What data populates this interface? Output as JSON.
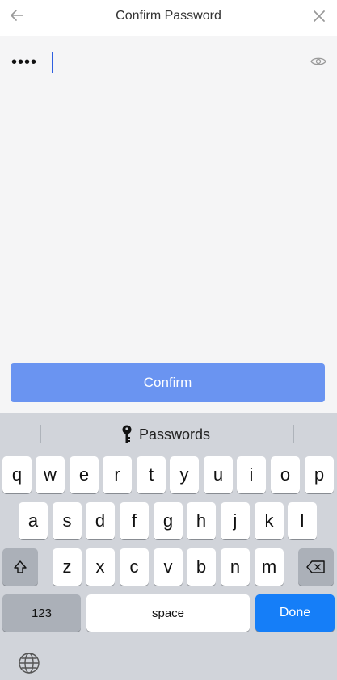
{
  "header": {
    "title": "Confirm Password"
  },
  "password": {
    "masked_value": "••••"
  },
  "confirm_button": {
    "label": "Confirm",
    "color": "#6a94f1"
  },
  "keyboard": {
    "suggestion": "Passwords",
    "row1": [
      "q",
      "w",
      "e",
      "r",
      "t",
      "y",
      "u",
      "i",
      "o",
      "p"
    ],
    "row2": [
      "a",
      "s",
      "d",
      "f",
      "g",
      "h",
      "j",
      "k",
      "l"
    ],
    "row3": [
      "z",
      "x",
      "c",
      "v",
      "b",
      "n",
      "m"
    ],
    "numbers_label": "123",
    "space_label": "space",
    "done_label": "Done",
    "done_color": "#157ef8",
    "icons": [
      "shift-icon",
      "backspace-icon",
      "globe-icon",
      "key-icon"
    ]
  }
}
